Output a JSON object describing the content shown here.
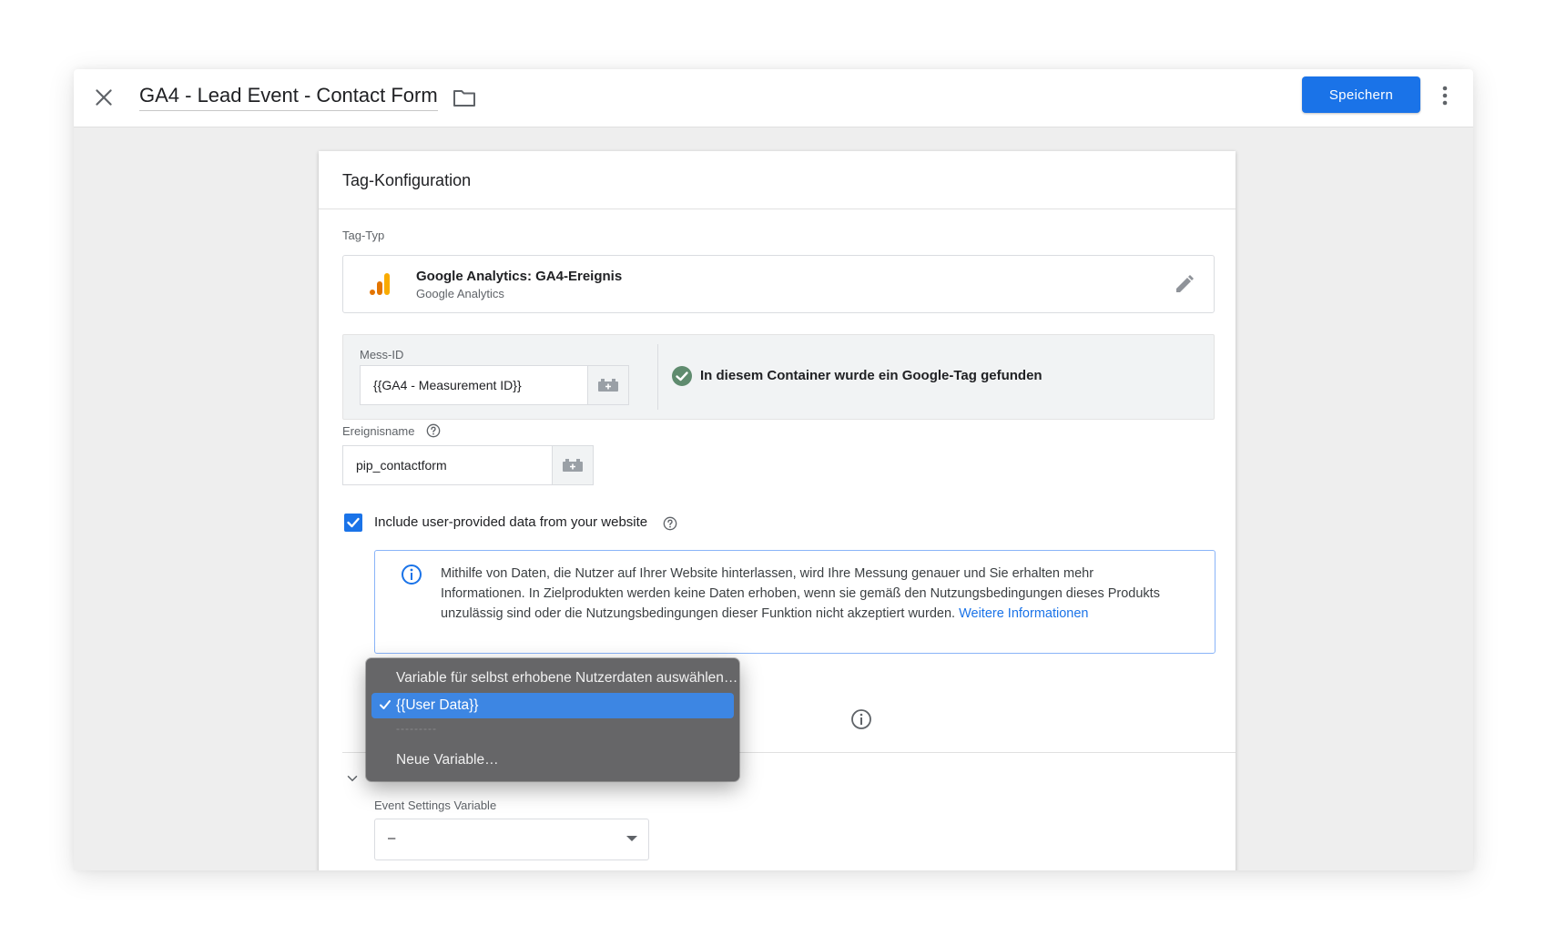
{
  "header": {
    "title": "GA4 - Lead Event - Contact Form",
    "save_label": "Speichern"
  },
  "card": {
    "title": "Tag-Konfiguration",
    "tag_type_label": "Tag-Typ",
    "tag_type_name": "Google Analytics: GA4-Ereignis",
    "tag_type_sub": "Google Analytics",
    "measurement_id_label": "Mess-ID",
    "measurement_id_value": "{{GA4 - Measurement ID}}",
    "google_tag_found": "In diesem Container wurde ein Google-Tag gefunden",
    "event_name_label": "Ereignisname",
    "event_name_value": "pip_contactform",
    "include_user_data_label": "Include user-provided data from your website",
    "include_user_data_checked": true,
    "info_text": "Mithilfe von Daten, die Nutzer auf Ihrer Website hinterlassen, wird Ihre Messung genauer und Sie erhalten mehr Informationen. In Zielprodukten werden keine Daten erhoben, wenn sie gemäß den Nutzungsbedingungen dieses Produkts unzulässig sind oder die Nutzungsbedingungen dieser Funktion nicht akzeptiert wurden.",
    "info_link": "Weitere Informationen",
    "event_settings_label": "Event Settings Variable",
    "event_settings_value": "–"
  },
  "dropdown": {
    "items": [
      "Variable für selbst erhobene Nutzerdaten auswählen…",
      "{{User Data}}",
      "---------",
      "Neue Variable…"
    ],
    "selected_index": 1
  },
  "colors": {
    "accent": "#1a73e8",
    "success": "#5f8b6e",
    "ga_orange": "#f9ab00",
    "ga_dark_orange": "#e37400",
    "dropdown_bg": "#666668",
    "dropdown_selected": "#3d86e3"
  },
  "icons": {
    "close": "close-icon",
    "folder": "folder-icon",
    "more": "more-vert-icon",
    "analytics": "google-analytics-icon",
    "edit": "pencil-icon",
    "variable": "variable-brick-icon",
    "check": "check-circle-icon",
    "help": "help-icon",
    "info": "info-icon",
    "chevron": "chevron-down-icon"
  }
}
